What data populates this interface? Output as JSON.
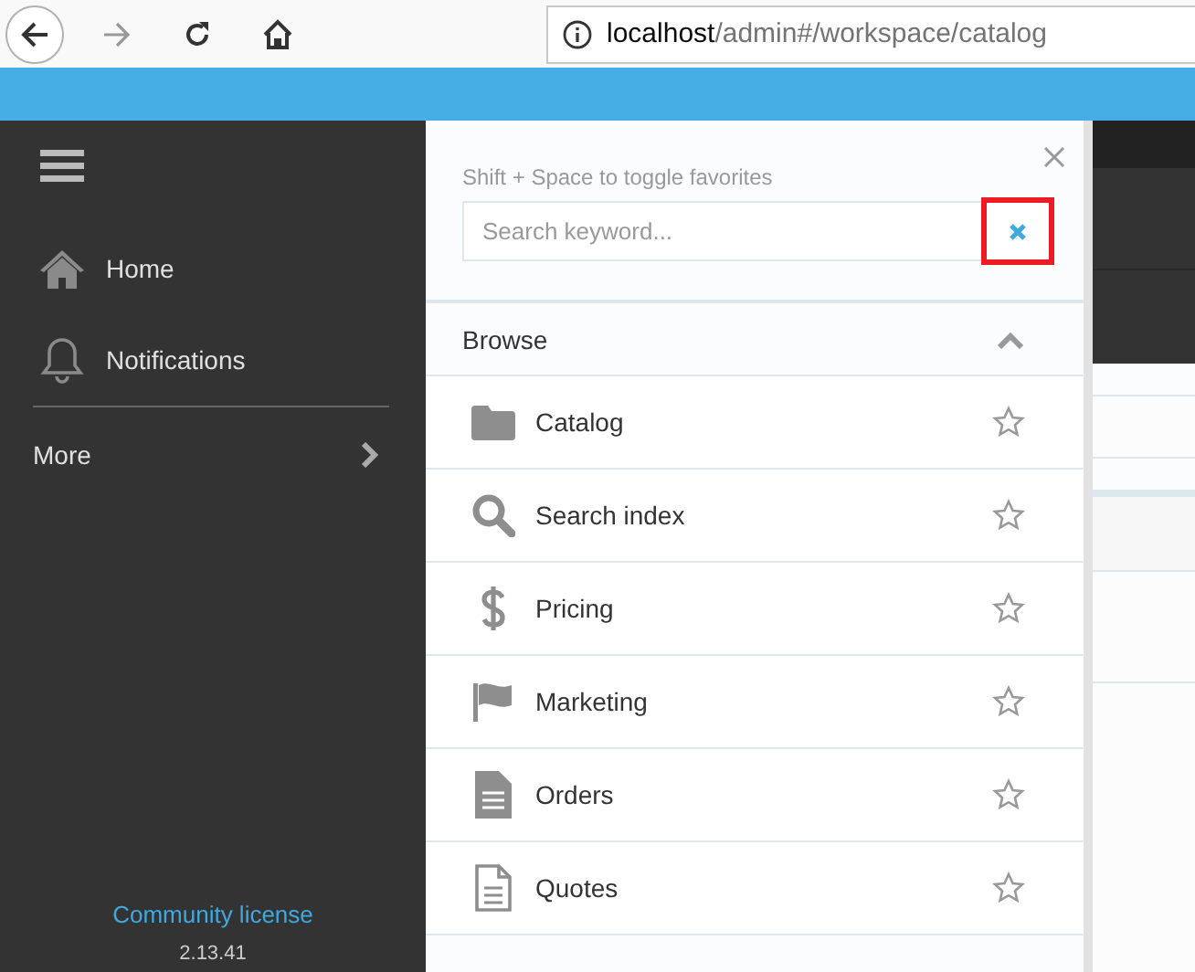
{
  "browser": {
    "url_host": "localhost",
    "url_path": "/admin#/workspace/catalog"
  },
  "sidebar": {
    "items": [
      {
        "label": "Home",
        "kind": "home"
      },
      {
        "label": "Notifications",
        "kind": "bell"
      },
      {
        "label": "More",
        "kind": "submenu"
      }
    ],
    "license": "Community license",
    "version": "2.13.41"
  },
  "panel": {
    "hint": "Shift + Space to toggle favorites",
    "search": {
      "placeholder": "Search keyword..."
    },
    "clear_highlighted": true,
    "browse": {
      "title": "Browse",
      "expanded": true,
      "items": [
        {
          "label": "Catalog",
          "kind": "folder",
          "favorite": false
        },
        {
          "label": "Search index",
          "kind": "search",
          "favorite": false
        },
        {
          "label": "Pricing",
          "kind": "dollar",
          "favorite": false
        },
        {
          "label": "Marketing",
          "kind": "flag",
          "favorite": false
        },
        {
          "label": "Orders",
          "kind": "document",
          "favorite": false
        },
        {
          "label": "Quotes",
          "kind": "document-outline",
          "favorite": false
        }
      ]
    }
  }
}
